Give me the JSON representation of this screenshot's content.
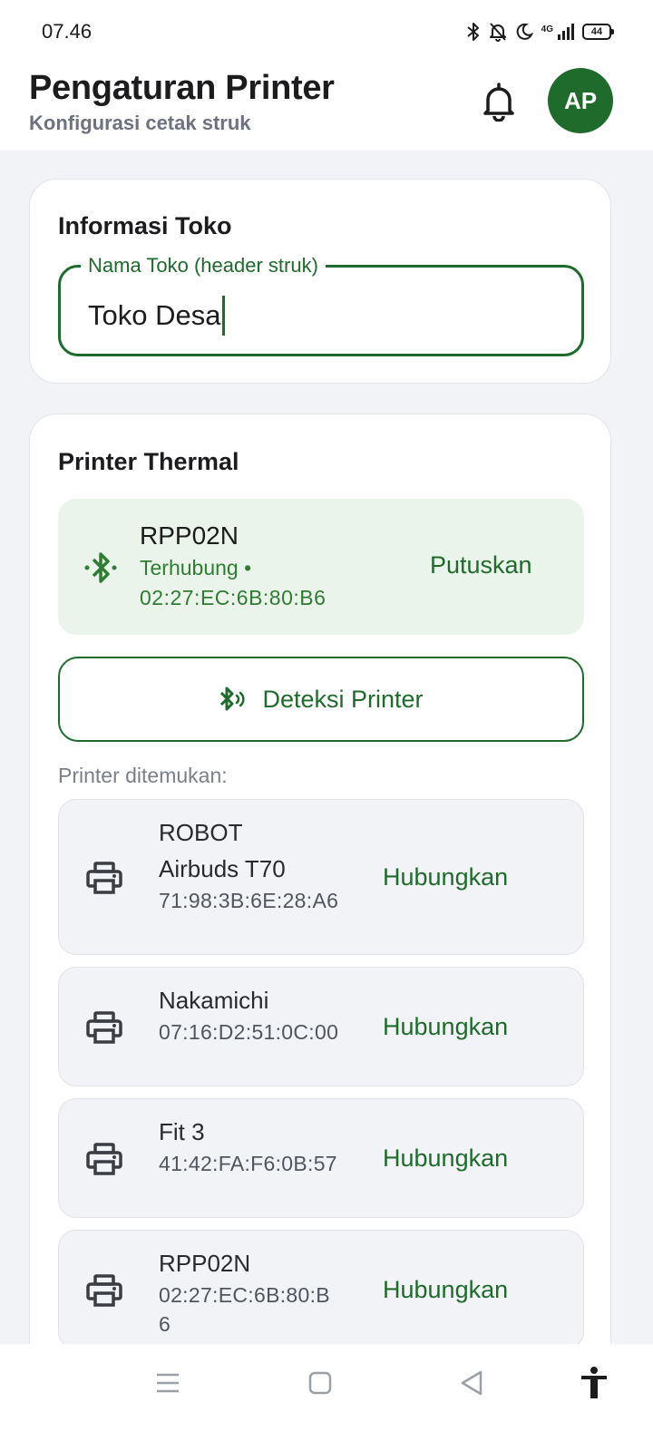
{
  "status_bar": {
    "time": "07.46",
    "network": "4G",
    "battery": "44",
    "icons": [
      "bluetooth-icon",
      "mute-icon",
      "moon-icon",
      "signal-icon",
      "battery-icon"
    ]
  },
  "header": {
    "title": "Pengaturan Printer",
    "subtitle": "Konfigurasi cetak struk",
    "avatar_initials": "AP"
  },
  "store_info": {
    "title": "Informasi Toko",
    "field_label": "Nama Toko (header struk)",
    "field_value": "Toko Desa"
  },
  "thermal": {
    "title": "Printer Thermal",
    "connected": {
      "name": "RPP02N",
      "status": "Terhubung •",
      "mac": "02:27:EC:6B:80:B6",
      "action": "Putuskan"
    },
    "scan_label": "Deteksi Printer",
    "found_label": "Printer ditemukan:",
    "devices": [
      {
        "name_lines": [
          "ROBOT",
          "Airbuds T70"
        ],
        "mac": "71:98:3B:6E:28:A6",
        "action": "Hubungkan"
      },
      {
        "name_lines": [
          "Nakamichi"
        ],
        "mac": "07:16:D2:51:0C:00",
        "action": "Hubungkan"
      },
      {
        "name_lines": [
          "Fit 3"
        ],
        "mac": "41:42:FA:F6:0B:57",
        "action": "Hubungkan"
      },
      {
        "name_lines": [
          "RPP02N"
        ],
        "mac": "02:27:EC:6B:80:B6",
        "action": "Hubungkan"
      }
    ]
  },
  "colors": {
    "accent": "#1e6b2c",
    "connected_bg": "#eaf4ea",
    "page_bg": "#f1f3f6"
  }
}
